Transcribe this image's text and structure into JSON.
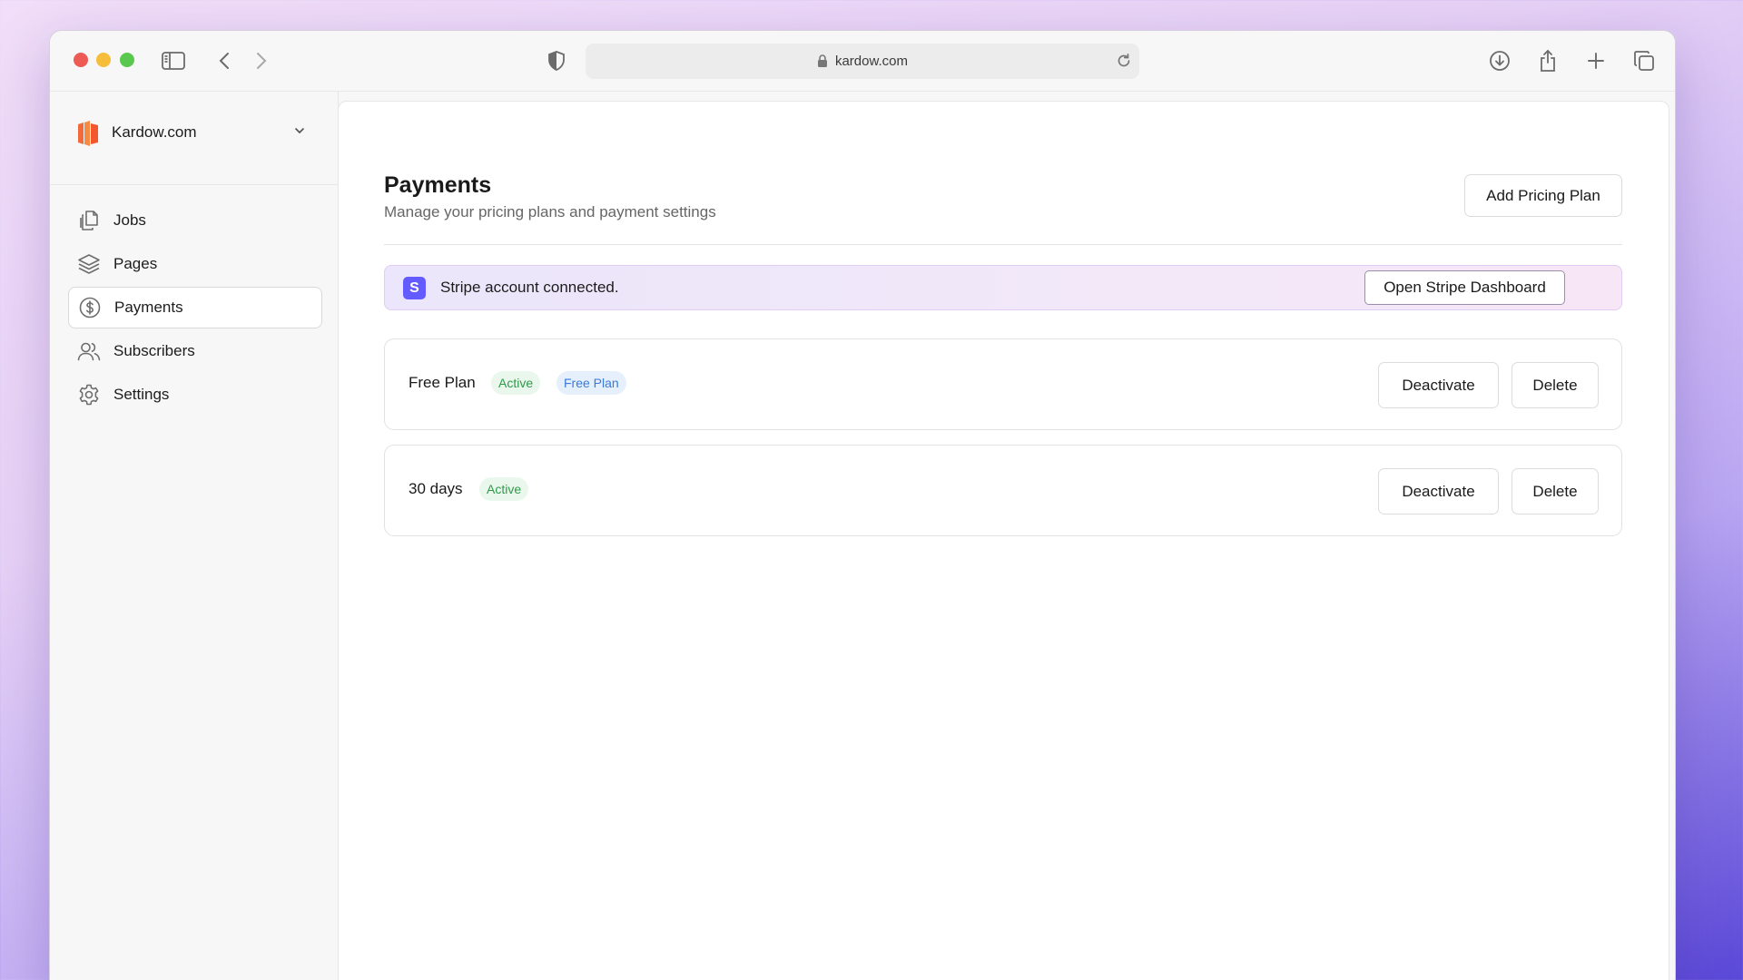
{
  "browser": {
    "url": "kardow.com"
  },
  "sidebar": {
    "org_name": "Kardow.com",
    "items": [
      {
        "label": "Jobs",
        "icon": "copy-icon"
      },
      {
        "label": "Pages",
        "icon": "layers-icon"
      },
      {
        "label": "Payments",
        "icon": "dollar-circle-icon",
        "active": true
      },
      {
        "label": "Subscribers",
        "icon": "users-icon"
      },
      {
        "label": "Settings",
        "icon": "gear-icon"
      }
    ]
  },
  "main": {
    "title": "Payments",
    "subtitle": "Manage your pricing plans and payment settings",
    "add_button": "Add Pricing Plan",
    "stripe": {
      "logo_letter": "S",
      "message": "Stripe account connected.",
      "button": "Open Stripe Dashboard"
    },
    "plans": [
      {
        "name": "Free Plan",
        "status": "Active",
        "tag": "Free Plan",
        "deactivate": "Deactivate",
        "delete": "Delete"
      },
      {
        "name": "30 days",
        "status": "Active",
        "deactivate": "Deactivate",
        "delete": "Delete"
      }
    ]
  },
  "colors": {
    "brand_orange": "#f26a3a",
    "stripe_purple": "#635bff",
    "badge_green": "#2f9a4a",
    "badge_blue": "#3a7ad9"
  }
}
